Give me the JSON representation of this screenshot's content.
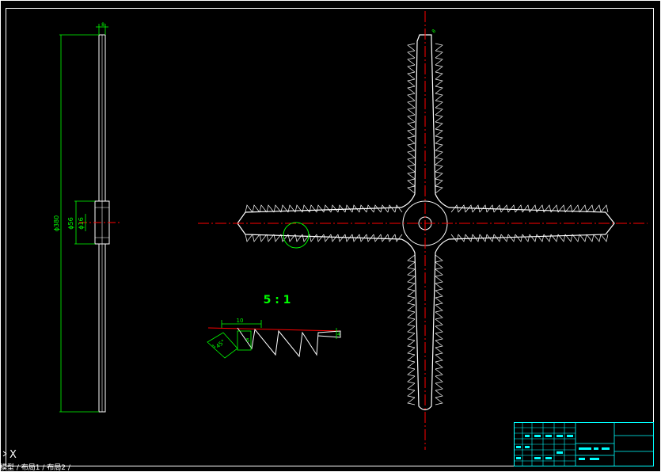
{
  "drawing": {
    "scale_label": "5 : 1",
    "dims": {
      "top_width": "8",
      "overall_diameter": "ϕ380",
      "hub_outer": "ϕ56",
      "hub_inner": "ϕ16",
      "tip_width": "8",
      "tooth_pitch": "10",
      "tooth_depth": "5",
      "tooth_angle": "45°",
      "blade_height": "4",
      "tooth_small": "1"
    }
  },
  "ucs": {
    "label": "X"
  },
  "layout_tabs": {
    "text": "模型 / 布局1 / 布局2 /"
  },
  "colors": {
    "background": "#000000",
    "line": "#ffffff",
    "dimension": "#00ff00",
    "centerline": "#ff0000",
    "title_block": "#00ffff"
  }
}
